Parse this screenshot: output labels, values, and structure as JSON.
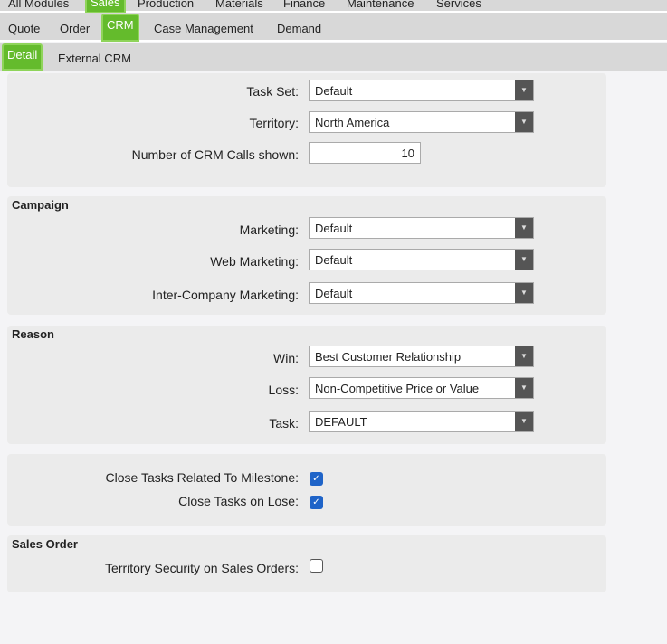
{
  "top_nav": [
    "All Modules",
    "Sales",
    "Production",
    "Materials",
    "Finance",
    "Maintenance",
    "Services"
  ],
  "sub_nav": [
    "Quote",
    "Order",
    "CRM",
    "Case Management",
    "Demand"
  ],
  "sub_sub_nav": [
    "Detail",
    "External CRM"
  ],
  "general": {
    "task_set_label": "Task Set:",
    "task_set": "Default",
    "territory_label": "Territory:",
    "territory": "North America",
    "calls_label": "Number of CRM Calls shown:",
    "calls": "10"
  },
  "campaign": {
    "title": "Campaign",
    "marketing_label": "Marketing:",
    "marketing": "Default",
    "web_label": "Web Marketing:",
    "web": "Default",
    "ic_label": "Inter-Company Marketing:",
    "ic": "Default"
  },
  "reason": {
    "title": "Reason",
    "win_label": "Win:",
    "win": "Best Customer Relationship",
    "loss_label": "Loss:",
    "loss": "Non-Competitive Price or Value",
    "task_label": "Task:",
    "task": "DEFAULT"
  },
  "tasks": {
    "milestone_label": "Close Tasks Related To Milestone:",
    "milestone": true,
    "lose_label": "Close Tasks on Lose:",
    "lose": true
  },
  "sales_order": {
    "title": "Sales Order",
    "security_label": "Territory Security on Sales Orders:",
    "security": false
  },
  "colors": {
    "accent": "#64bb2c",
    "checkbox": "#1f64c8"
  }
}
